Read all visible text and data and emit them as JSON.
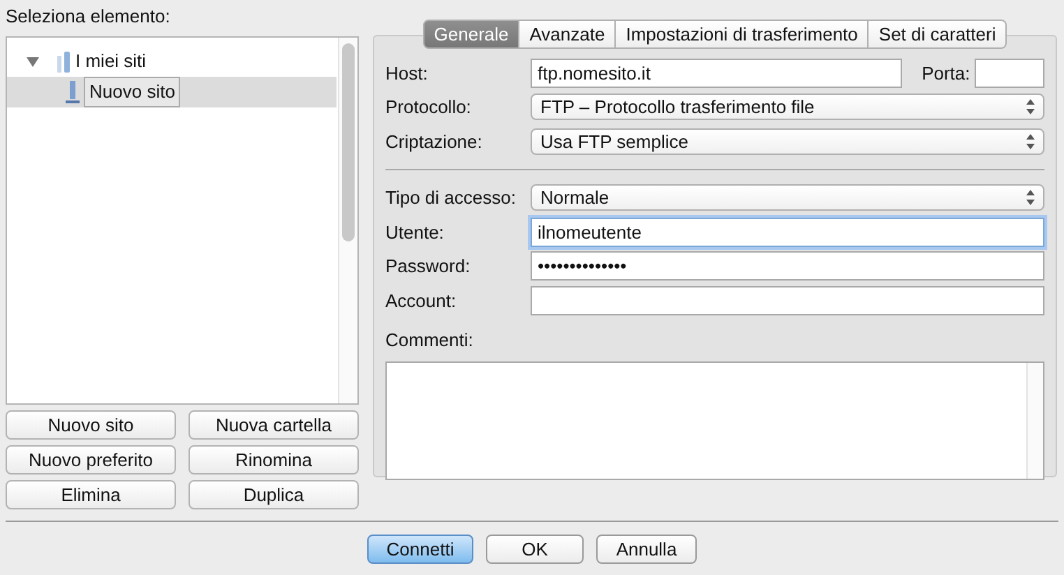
{
  "site_manager": {
    "label": "Seleziona elemento:",
    "tree": [
      {
        "label": "I miei siti",
        "expanded": true,
        "selected": false,
        "children": [
          {
            "label": "Nuovo sito",
            "selected": true
          }
        ]
      }
    ],
    "buttons": [
      "Nuovo sito",
      "Nuova cartella",
      "Nuovo preferito",
      "Rinomina",
      "Elimina",
      "Duplica"
    ]
  },
  "tabs": [
    {
      "label": "Generale",
      "selected": true
    },
    {
      "label": "Avanzate",
      "selected": false
    },
    {
      "label": "Impostazioni di trasferimento",
      "selected": false
    },
    {
      "label": "Set di caratteri",
      "selected": false
    }
  ],
  "server_fields": [
    {
      "kind": "host",
      "label": "Host:",
      "value": "ftp.nomesito.it",
      "port_label": "Porta:"
    },
    {
      "kind": "select",
      "label": "Protocollo:",
      "value": "FTP – Protocollo trasferimento file"
    },
    {
      "kind": "select",
      "label": "Criptazione:",
      "value": "Usa FTP semplice"
    }
  ],
  "login_fields": [
    {
      "kind": "select",
      "label": "Tipo di accesso:",
      "value": "Normale",
      "focused": false
    },
    {
      "kind": "text",
      "label": "Utente:",
      "value": "ilnomeutente",
      "focused": true
    },
    {
      "kind": "text",
      "label": "Password:",
      "value": "••••••••••••••",
      "focused": false
    },
    {
      "kind": "text",
      "label": "Account:",
      "focused": false
    }
  ],
  "comments": {
    "label": "Commenti:"
  },
  "footer_buttons": [
    {
      "label": "Connetti",
      "default": true
    },
    {
      "label": "OK",
      "default": false
    },
    {
      "label": "Annulla",
      "default": false
    }
  ]
}
